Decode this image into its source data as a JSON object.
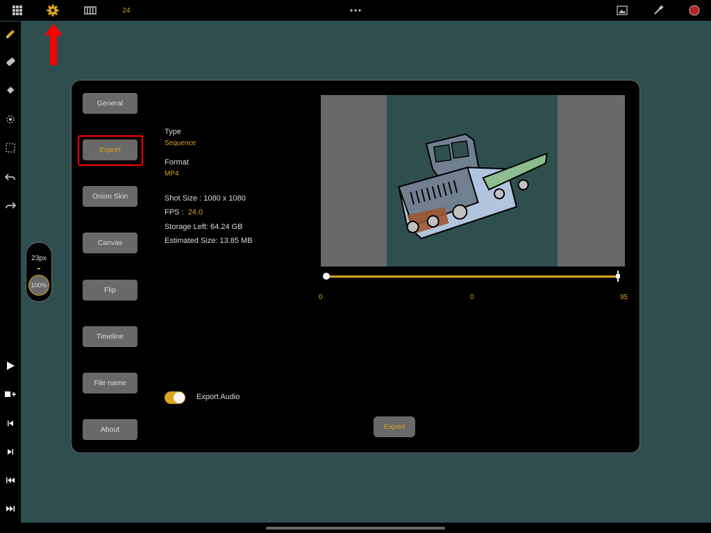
{
  "topbar": {
    "frame_count": "24",
    "colors": {
      "accent": "goldenrod",
      "record": "firebrick"
    },
    "icons": [
      "grid-icon",
      "gear-icon",
      "film-strip-icon",
      "more-dots-icon",
      "image-icon",
      "eyedropper-icon",
      "color-swatch-icon"
    ]
  },
  "toolbar": {
    "icons": [
      "pencil-icon",
      "eraser-icon",
      "paint-bucket-icon",
      "lasso-icon",
      "selection-icon",
      "undo-icon",
      "redo-icon",
      "play-icon",
      "add-frame-icon",
      "previous-frame-icon",
      "next-frame-icon",
      "first-frame-icon",
      "last-frame-icon"
    ]
  },
  "brush": {
    "size": "23px",
    "opacity": "100%"
  },
  "settings": {
    "menu": [
      "General",
      "Export",
      "Onion Skin",
      "Canvas",
      "Flip",
      "Timeline",
      "File name",
      "About"
    ],
    "active_menu": "Export",
    "type_label": "Type",
    "type_value": "Sequence",
    "format_label": "Format",
    "format_value": "MP4",
    "shot_size": "Shot Size :  1080 x 1080",
    "fps_label": "FPS :",
    "fps_value": "24.0",
    "storage_left": "Storage Left: 64.24 GB",
    "estimated_size": "Estimated Size: 13.85 MB",
    "range_start": "0",
    "range_current": "0",
    "range_end": "95",
    "export_audio_label": "Export Audio",
    "export_audio_enabled": true,
    "export_button": "Export"
  }
}
